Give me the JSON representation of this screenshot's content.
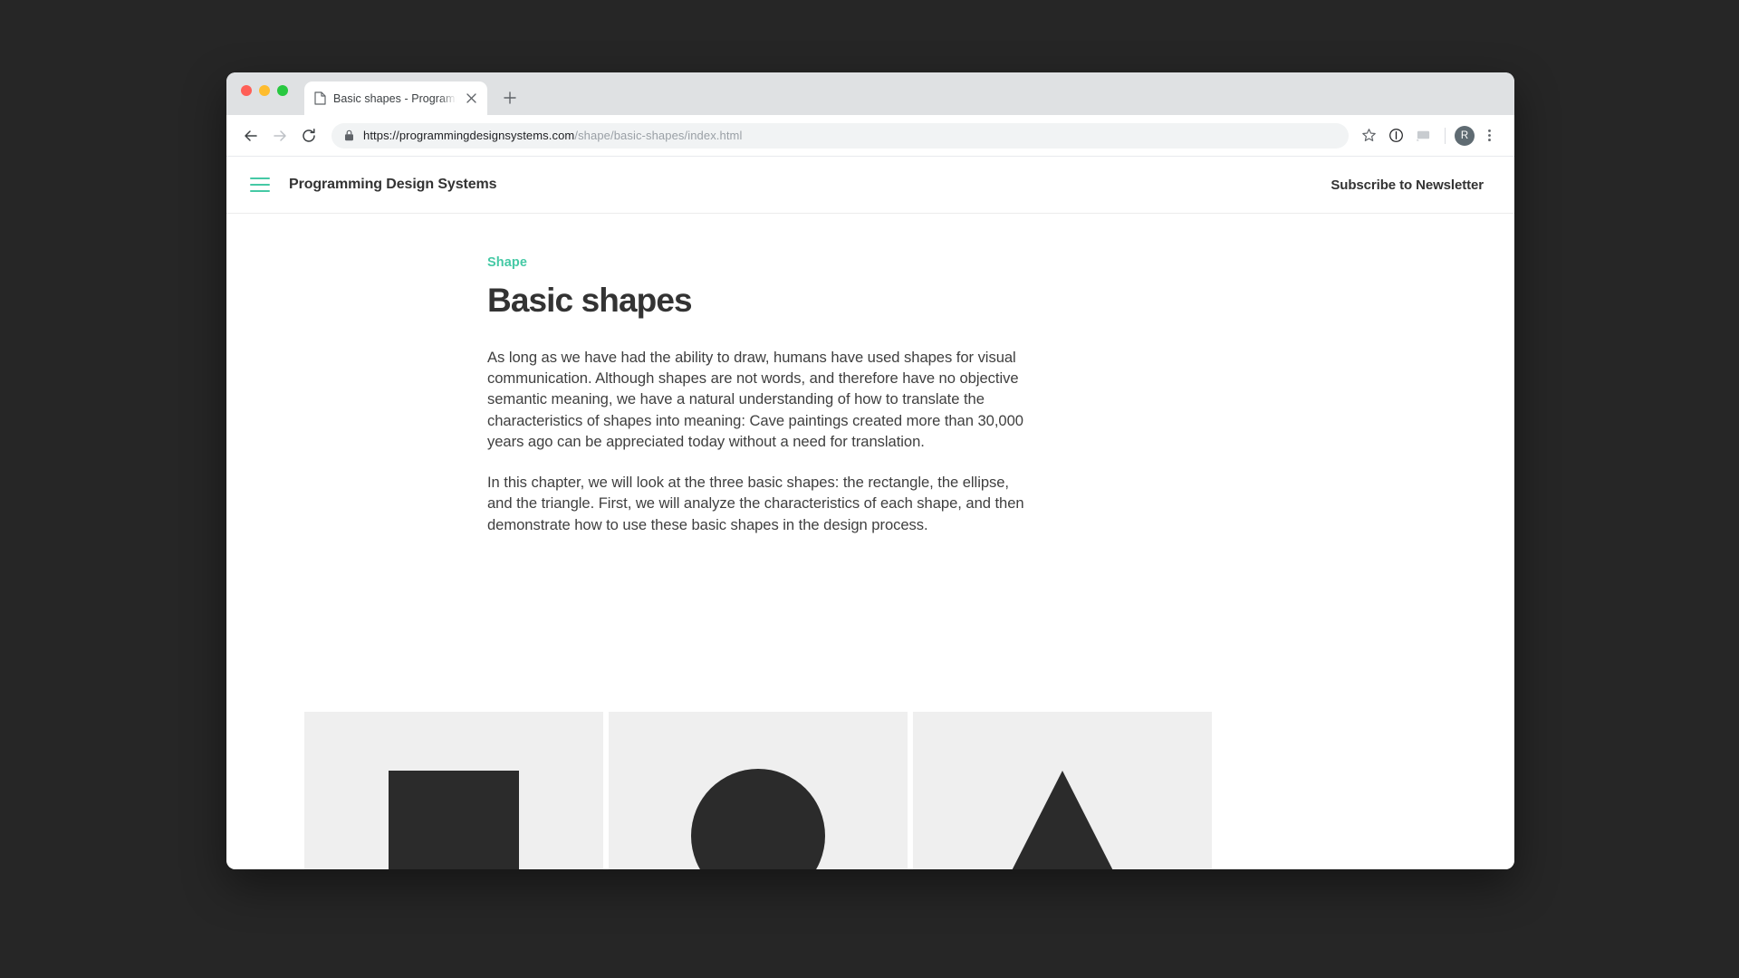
{
  "browser": {
    "traffic_lights": [
      "close",
      "minimize",
      "maximize"
    ],
    "tab": {
      "title": "Basic shapes - Programming D",
      "favicon": "page-icon",
      "close_label": "×"
    },
    "new_tab_label": "+",
    "toolbar": {
      "back_label": "←",
      "forward_label": "→",
      "reload_label": "↻",
      "security_icon": "lock-icon",
      "url_host": "https://programmingdesignsystems.com",
      "url_path": "/shape/basic-shapes/index.html",
      "bookmark_icon": "star-icon",
      "info_icon": "info-circle-icon",
      "cast_icon": "cast-icon",
      "avatar_initial": "R",
      "menu_icon": "three-dot-menu-icon"
    }
  },
  "site": {
    "menu_icon": "hamburger-menu-icon",
    "title": "Programming Design Systems",
    "newsletter_label": "Subscribe to Newsletter",
    "accent_color": "#45c9a5"
  },
  "article": {
    "eyebrow": "Shape",
    "title": "Basic shapes",
    "paragraphs": [
      "As long as we have had the ability to draw, humans have used shapes for visual communication. Although shapes are not words, and therefore have no objective semantic meaning, we have a natural understanding of how to translate the characteristics of shapes into meaning: Cave paintings created more than 30,000 years ago can be appreciated today without a need for translation.",
      "In this chapter, we will look at the three basic shapes: the rectangle, the ellipse, and the triangle. First, we will analyze the characteristics of each shape, and then demonstrate how to use these basic shapes in the design process."
    ],
    "figures": [
      {
        "shape": "rectangle",
        "fill": "#2b2b2b",
        "background": "#efefef"
      },
      {
        "shape": "ellipse",
        "fill": "#2b2b2b",
        "background": "#efefef"
      },
      {
        "shape": "triangle",
        "fill": "#2b2b2b",
        "background": "#efefef"
      }
    ]
  }
}
